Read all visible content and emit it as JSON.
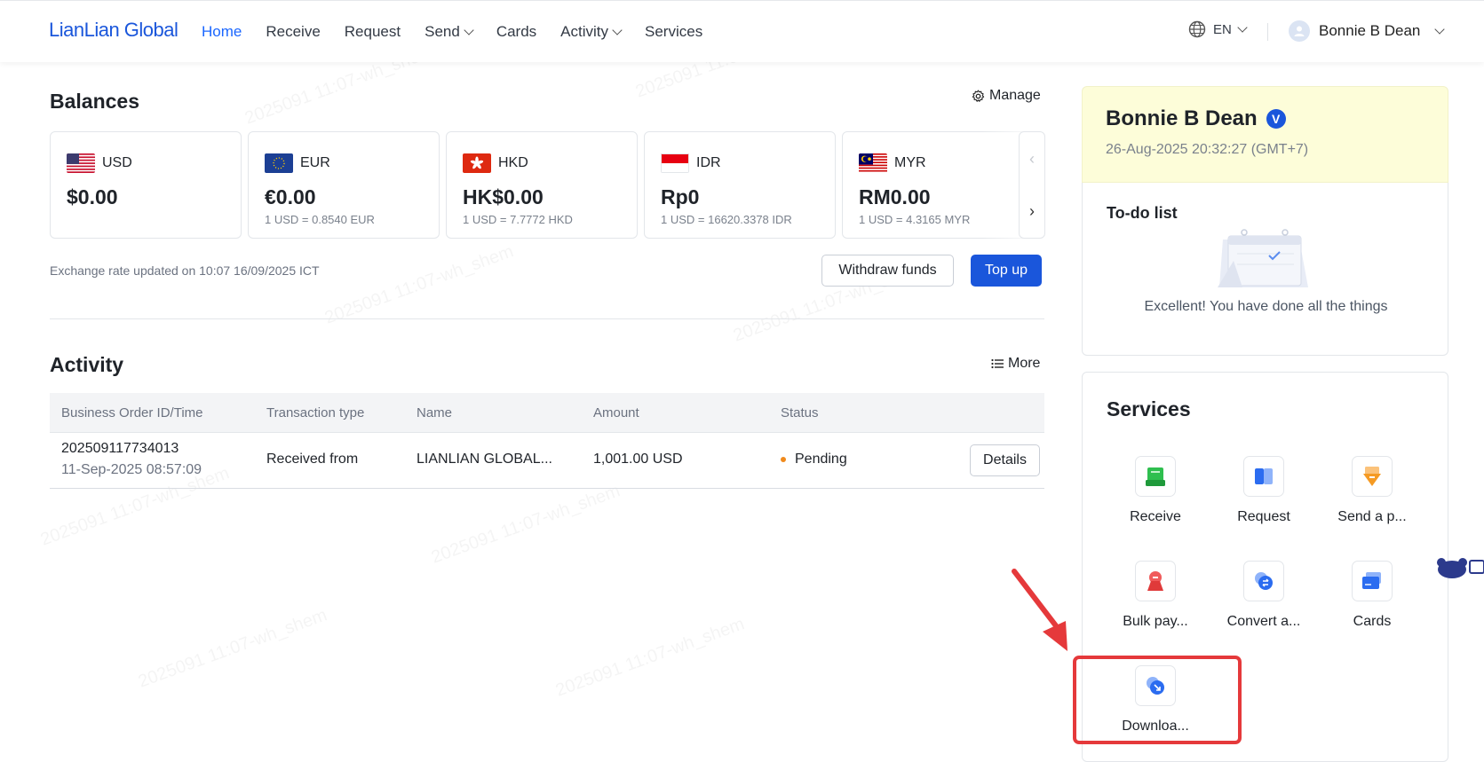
{
  "nav": {
    "logo": "LianLian Global",
    "items": [
      {
        "label": "Home",
        "active": true,
        "dropdown": false
      },
      {
        "label": "Receive",
        "active": false,
        "dropdown": false
      },
      {
        "label": "Request",
        "active": false,
        "dropdown": false
      },
      {
        "label": "Send",
        "active": false,
        "dropdown": true
      },
      {
        "label": "Cards",
        "active": false,
        "dropdown": false
      },
      {
        "label": "Activity",
        "active": false,
        "dropdown": true
      },
      {
        "label": "Services",
        "active": false,
        "dropdown": false
      }
    ],
    "language": "EN",
    "user_name": "Bonnie B Dean"
  },
  "balances": {
    "title": "Balances",
    "manage_label": "Manage",
    "cards": [
      {
        "currency": "USD",
        "amount": "$0.00",
        "rate": ""
      },
      {
        "currency": "EUR",
        "amount": "€0.00",
        "rate": "1 USD = 0.8540 EUR"
      },
      {
        "currency": "HKD",
        "amount": "HK$0.00",
        "rate": "1 USD = 7.7772 HKD"
      },
      {
        "currency": "IDR",
        "amount": "Rp0",
        "rate": "1 USD = 16620.3378 IDR"
      },
      {
        "currency": "MYR",
        "amount": "RM0.00",
        "rate": "1 USD = 4.3165 MYR"
      }
    ],
    "exchange_note": "Exchange rate updated on 10:07 16/09/2025 ICT",
    "withdraw_label": "Withdraw funds",
    "topup_label": "Top up"
  },
  "activity": {
    "title": "Activity",
    "more_label": "More",
    "columns": [
      "Business Order ID/Time",
      "Transaction type",
      "Name",
      "Amount",
      "Status"
    ],
    "rows": [
      {
        "order_id": "202509117734013",
        "time": "11-Sep-2025 08:57:09",
        "type": "Received from",
        "name": "LIANLIAN GLOBAL...",
        "amount": "1,001.00 USD",
        "status": "Pending",
        "details_label": "Details"
      }
    ]
  },
  "profile": {
    "name": "Bonnie B Dean",
    "badge": "V",
    "datetime": "26-Aug-2025 20:32:27 (GMT+7)"
  },
  "todo": {
    "title": "To-do list",
    "message": "Excellent! You have done all the things"
  },
  "services": {
    "title": "Services",
    "items": [
      {
        "label": "Receive",
        "icon": "receive-icon"
      },
      {
        "label": "Request",
        "icon": "request-icon"
      },
      {
        "label": "Send a p...",
        "icon": "send-payment-icon"
      },
      {
        "label": "Bulk pay...",
        "icon": "bulk-payment-icon"
      },
      {
        "label": "Convert a...",
        "icon": "convert-icon"
      },
      {
        "label": "Cards",
        "icon": "cards-icon"
      },
      {
        "label": "Downloa...",
        "icon": "download-icon"
      }
    ]
  },
  "colors": {
    "brand": "#1a56db",
    "highlight": "#e5393b",
    "pending": "#f08a1c"
  }
}
